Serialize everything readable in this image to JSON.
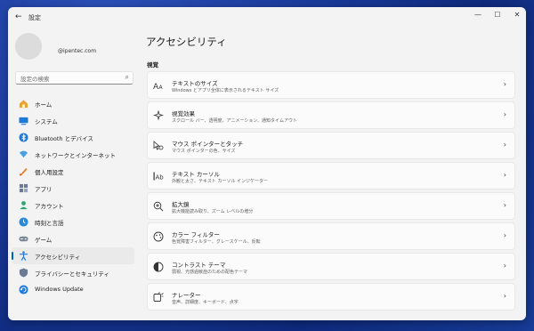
{
  "window": {
    "title": "設定",
    "back_glyph": "←",
    "min_glyph": "—",
    "max_glyph": "☐",
    "close_glyph": "✕"
  },
  "user": {
    "email": "@ipentec.com"
  },
  "search": {
    "placeholder": "設定の検索"
  },
  "sidebar": {
    "items": [
      {
        "label": "ホーム",
        "icon": "home-icon",
        "color": "#e8a23c"
      },
      {
        "label": "システム",
        "icon": "system-icon",
        "color": "#1f7ad6"
      },
      {
        "label": "Bluetooth とデバイス",
        "icon": "bluetooth-icon",
        "color": "#1f7ad6"
      },
      {
        "label": "ネットワークとインターネット",
        "icon": "network-icon",
        "color": "#4a9fe0"
      },
      {
        "label": "個人用設定",
        "icon": "personalization-icon",
        "color": "#e8832f"
      },
      {
        "label": "アプリ",
        "icon": "apps-icon",
        "color": "#6c7b95"
      },
      {
        "label": "アカウント",
        "icon": "account-icon",
        "color": "#2ea66b"
      },
      {
        "label": "時刻と言語",
        "icon": "time-language-icon",
        "color": "#2a8ad8"
      },
      {
        "label": "ゲーム",
        "icon": "gaming-icon",
        "color": "#7b8696"
      },
      {
        "label": "アクセシビリティ",
        "icon": "accessibility-icon",
        "color": "#1f7ad6",
        "active": true
      },
      {
        "label": "プライバシーとセキュリティ",
        "icon": "privacy-icon",
        "color": "#6c7b95"
      },
      {
        "label": "Windows Update",
        "icon": "windows-update-icon",
        "color": "#1f7ad6"
      }
    ]
  },
  "main": {
    "title": "アクセシビリティ",
    "section": "視覚",
    "cards": [
      {
        "title": "テキストのサイズ",
        "desc": "Windows とアプリ全体に表示されるテキスト サイズ",
        "icon": "text-size-icon"
      },
      {
        "title": "視覚効果",
        "desc": "スクロール バー、透明度、アニメーション、通知タイムアウト",
        "icon": "visual-effects-icon"
      },
      {
        "title": "マウス ポインターとタッチ",
        "desc": "マウス ポインターの色、サイズ",
        "icon": "mouse-pointer-icon"
      },
      {
        "title": "テキスト カーソル",
        "desc": "外観と太さ、テキスト カーソル インジケーター",
        "icon": "text-cursor-icon"
      },
      {
        "title": "拡大鏡",
        "desc": "拡大機能読み取り、ズーム レベルの増分",
        "icon": "magnifier-icon"
      },
      {
        "title": "カラー フィルター",
        "desc": "色覚障害フィルター、グレースケール、反転",
        "icon": "color-filter-icon"
      },
      {
        "title": "コントラスト テーマ",
        "desc": "弱視、光感過敏症のための配色テーマ",
        "icon": "contrast-icon"
      },
      {
        "title": "ナレーター",
        "desc": "音声、詳細度、キーボード、点字",
        "icon": "narrator-icon"
      }
    ],
    "chevron": "›"
  }
}
